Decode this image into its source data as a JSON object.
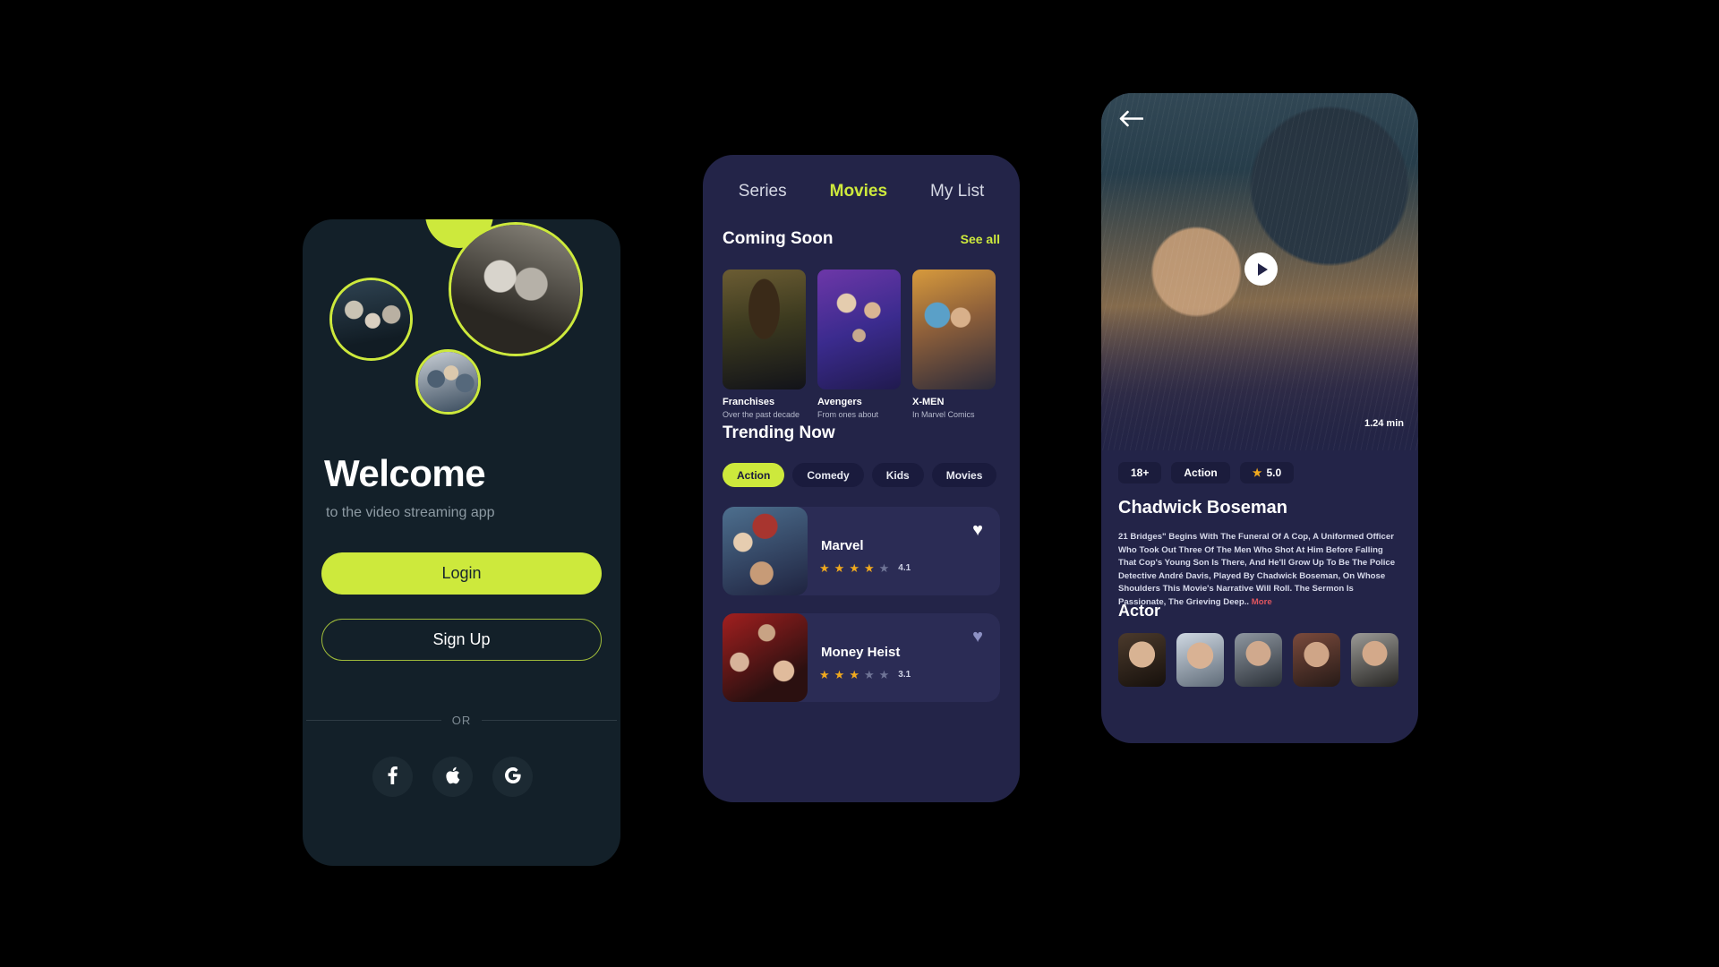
{
  "welcome_screen": {
    "bubbles": [
      {
        "name": "accent-blob"
      },
      {
        "name": "harry-potter-poster"
      },
      {
        "name": "couple-poster"
      },
      {
        "name": "group-poster"
      }
    ],
    "title": "Welcome",
    "subtitle": "to the video streaming app",
    "login_label": "Login",
    "signup_label": "Sign Up",
    "divider_label": "OR",
    "social": [
      {
        "icon": "facebook-icon",
        "glyph": "f"
      },
      {
        "icon": "apple-icon",
        "glyph": ""
      },
      {
        "icon": "google-icon",
        "glyph": "G"
      }
    ],
    "accent_color": "#cde93c",
    "background_color": "#132029"
  },
  "movies_screen": {
    "tabs": [
      {
        "label": "Series",
        "active": false
      },
      {
        "label": "Movies",
        "active": true
      },
      {
        "label": "My List",
        "active": false
      }
    ],
    "coming_soon": {
      "title": "Coming Soon",
      "see_all_label": "See all",
      "items": [
        {
          "name": "Franchises",
          "desc": "Over the past decade"
        },
        {
          "name": "Avengers",
          "desc": "From ones about"
        },
        {
          "name": "X-MEN",
          "desc": "In Marvel Comics"
        }
      ]
    },
    "trending": {
      "title": "Trending Now",
      "chips": [
        {
          "label": "Action",
          "active": true
        },
        {
          "label": "Comedy",
          "active": false
        },
        {
          "label": "Kids",
          "active": false
        },
        {
          "label": "Movies",
          "active": false
        }
      ],
      "items": [
        {
          "name": "Marvel",
          "rating": "4.1",
          "stars_filled": 4,
          "stars_total": 5,
          "favorited": true
        },
        {
          "name": "Money Heist",
          "rating": "3.1",
          "stars_filled": 3,
          "stars_total": 5,
          "favorited": false
        }
      ]
    },
    "accent_color": "#cde93c",
    "background_color": "#232448"
  },
  "detail_screen": {
    "back_icon": "arrow-left-icon",
    "play_icon": "play-icon",
    "duration": "1.24 min",
    "badges": [
      {
        "label": "18+",
        "icon": null
      },
      {
        "label": "Action",
        "icon": null
      },
      {
        "label": "5.0",
        "icon": "star-icon"
      }
    ],
    "title": "Chadwick Boseman",
    "description": "21 Bridges\" Begins With The Funeral Of A Cop, A Uniformed Officer Who Took Out Three Of The Men Who Shot At Him Before Falling That Cop's Young Son Is There, And He'll Grow Up To Be The Police Detective André Davis, Played By Chadwick Boseman, On Whose Shoulders This Movie's Narrative Will Roll. The Sermon Is Passionate, The Grieving Deep..",
    "more_label": "More",
    "actor_section_title": "Actor",
    "actors": [
      {
        "name": "actor-1"
      },
      {
        "name": "actor-2"
      },
      {
        "name": "actor-3"
      },
      {
        "name": "actor-4"
      },
      {
        "name": "actor-5"
      }
    ],
    "background_color": "#232448"
  }
}
